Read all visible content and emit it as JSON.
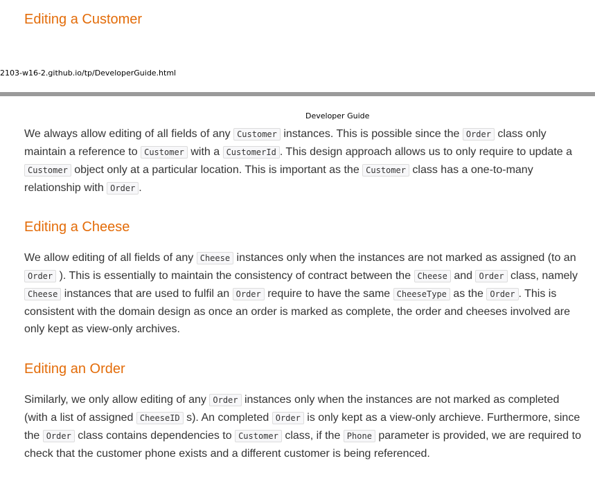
{
  "sections": {
    "customer_heading": "Editing a Customer",
    "cheese_heading": "Editing a Cheese",
    "order_heading": "Editing an Order"
  },
  "print": {
    "url": "2103-w16-2.github.io/tp/DeveloperGuide.html",
    "header": "Developer Guide"
  },
  "customer_para": [
    "We always allow editing of all fields of any ",
    "Customer",
    " instances. This is possible since the ",
    "Order",
    " class only maintain a reference to ",
    "Customer",
    " with a ",
    "CustomerId",
    ". This design approach allows us to only require to update a ",
    "Customer",
    " object only at a particular location. This is important as the ",
    "Customer",
    " class has a one-to-many relationship with ",
    "Order",
    "."
  ],
  "cheese_para": [
    "We allow editing of all fields of any ",
    "Cheese",
    " instances only when the instances are not marked as assigned (to an ",
    "Order",
    " ). This is essentially to maintain the consistency of contract between the ",
    "Cheese",
    " and ",
    "Order",
    " class, namely ",
    "Cheese",
    " instances that are used to fulfil an ",
    "Order",
    " require to have the same ",
    "CheeseType",
    " as the ",
    "Order",
    ". This is consistent with the domain design as once an order is marked as complete, the order and cheeses involved are only kept as view-only archives."
  ],
  "order_para": [
    "Similarly, we only allow editing of any ",
    "Order",
    " instances only when the instances are not marked as completed (with a list of assigned ",
    "CheeseID",
    " s). An completed ",
    "Order",
    " is only kept as a view-only archieve. Furthermore, since the ",
    "Order",
    " class contains dependencies to ",
    "Customer",
    " class, if the ",
    "Phone",
    " parameter is provided, we are required to check that the customer phone exists and a different customer is being referenced."
  ]
}
